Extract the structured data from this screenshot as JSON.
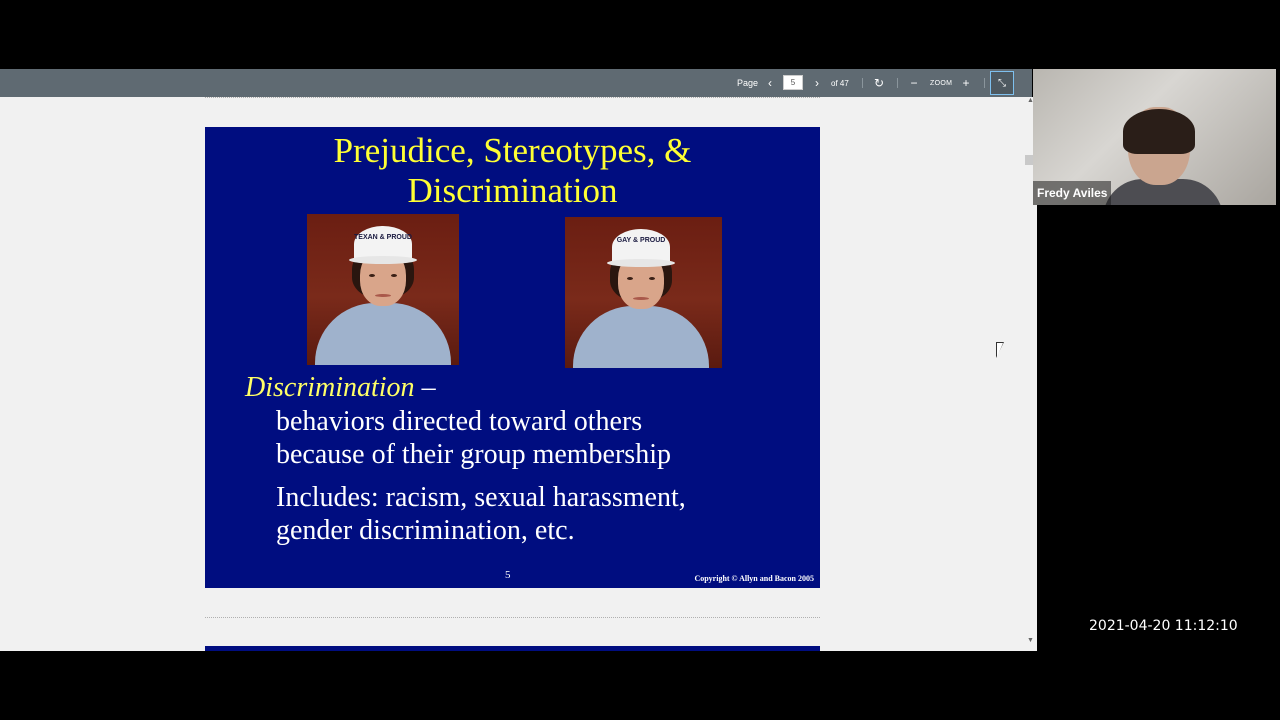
{
  "toolbar": {
    "page_label": "Page",
    "current_page": "5",
    "of_pages": "of 47",
    "zoom_label": "ZOOM",
    "prev_icon": "chevron-left-icon",
    "next_icon": "chevron-right-icon",
    "rotate_icon": "rotate-icon",
    "zoom_out_icon": "minus-icon",
    "zoom_in_icon": "plus-icon",
    "collapse_icon": "collapse-icon"
  },
  "slide": {
    "title_line1": "Prejudice, Stereotypes, &",
    "title_line2": "Discrimination",
    "photo1_cap": "TEXAN & PROUD",
    "photo2_cap": "GAY & PROUD",
    "term": "Discrimination",
    "term_dash": " –",
    "body1_line1": "behaviors directed toward others",
    "body1_line2": "because of their group membership",
    "body2_line1": "Includes: racism, sexual harassment,",
    "body2_line2": "gender discrimination, etc.",
    "number": "5",
    "copyright": "Copyright © Allyn and Bacon 2005"
  },
  "video": {
    "name": "Fredy Aviles"
  },
  "timestamp": "2021-04-20 11:12:10",
  "colors": {
    "slide_bg": "#000d80",
    "title": "#ffff33",
    "toolbar": "#5f6a72"
  }
}
